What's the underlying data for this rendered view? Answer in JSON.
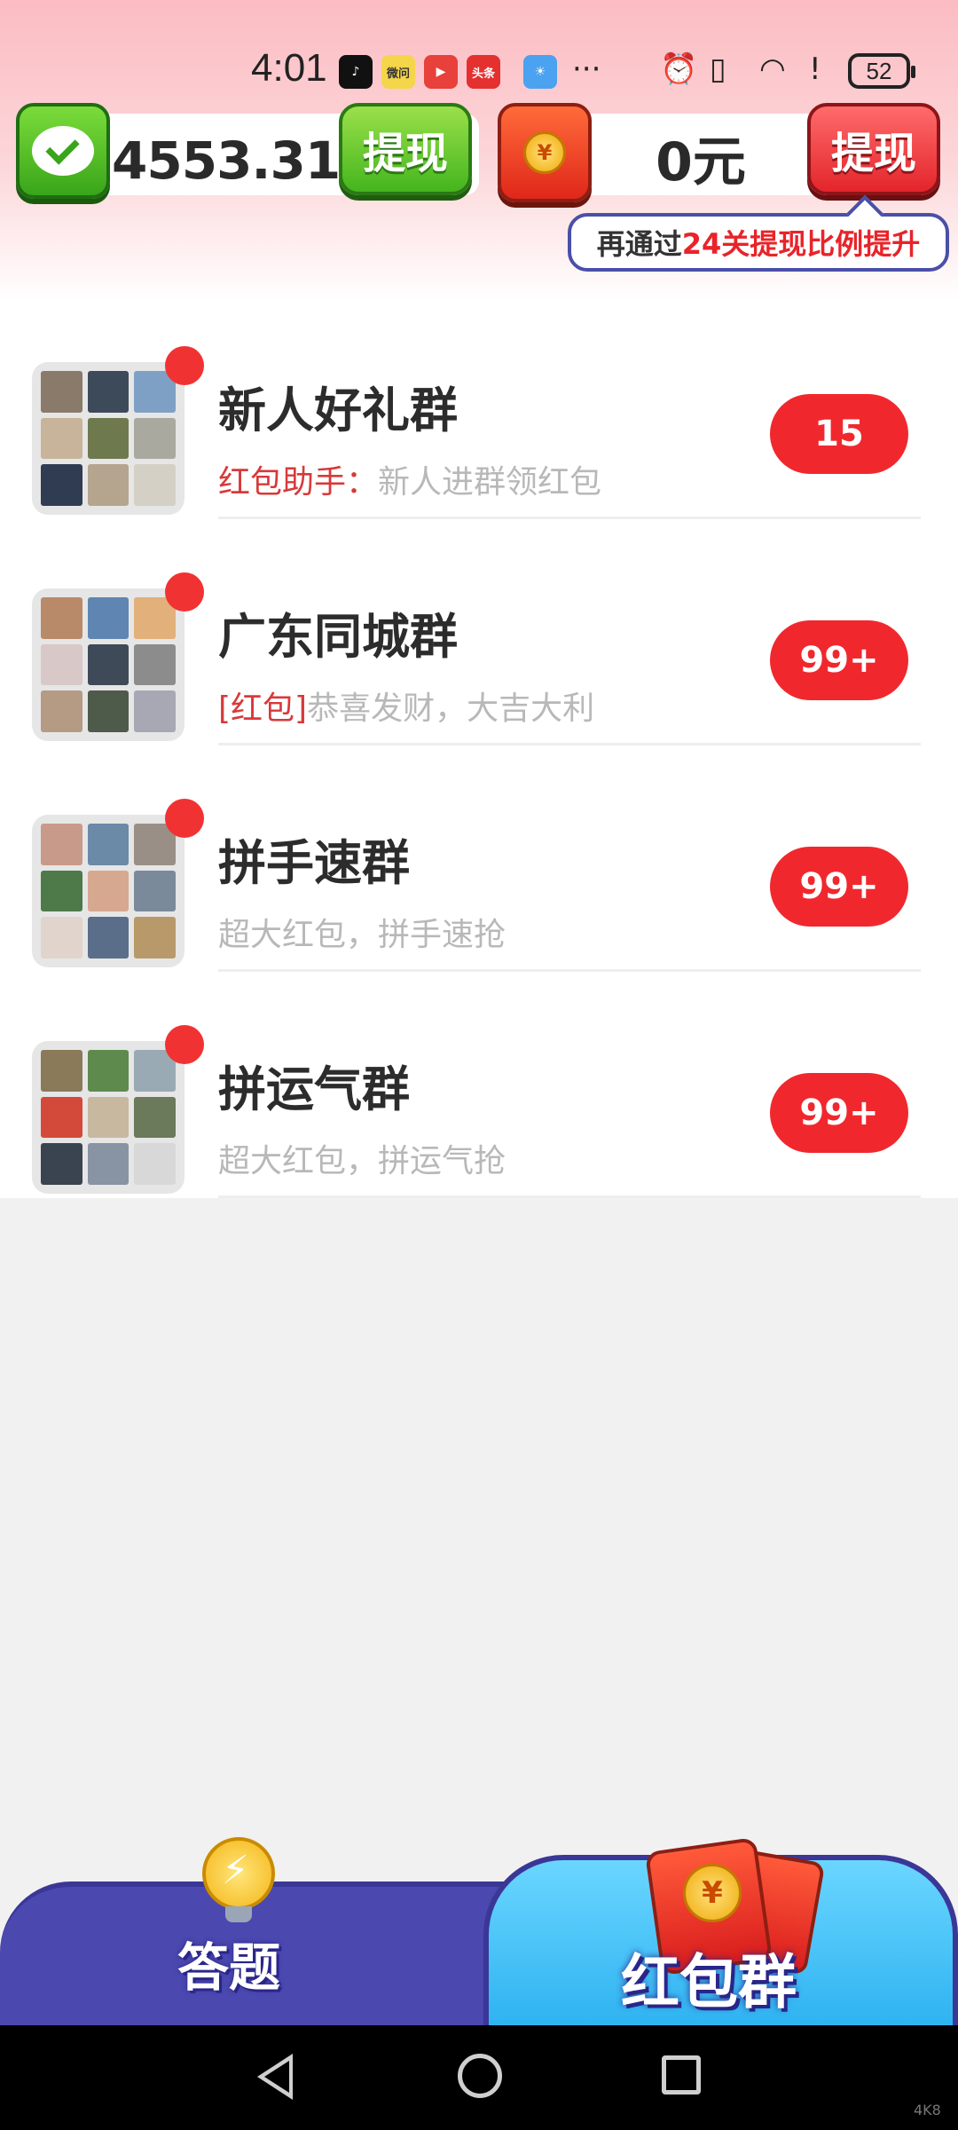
{
  "status_bar": {
    "time": "4:01",
    "apps": [
      "douyin-app-icon",
      "weiwen-app-icon",
      "video-app-icon",
      "toutiao-app-icon",
      "weather-app-icon"
    ],
    "app_labels": [
      "",
      "微问",
      "",
      "头条",
      ""
    ],
    "more": "···",
    "battery": "52"
  },
  "wallet": {
    "balance": "4553.31元",
    "withdraw_label": "提现"
  },
  "pocket": {
    "coin_symbol": "¥",
    "amount": "0元",
    "withdraw_label": "提现"
  },
  "tooltip": {
    "prefix": "再通过",
    "highlight": "24关提现比例提升"
  },
  "groups": [
    {
      "name": "新人好礼群",
      "preview_tag": "红包助手：",
      "preview_text": "新人进群领红包",
      "badge": "15",
      "tag_color": "#d8393a"
    },
    {
      "name": "广东同城群",
      "preview_tag": "[红包]",
      "preview_text": "恭喜发财，大吉大利",
      "badge": "99+"
    },
    {
      "name": "拼手速群",
      "preview_tag": "",
      "preview_text": "超大红包，拼手速抢",
      "badge": "99+"
    },
    {
      "name": "拼运气群",
      "preview_tag": "",
      "preview_text": "超大红包，拼运气抢",
      "badge": "99+"
    }
  ],
  "tabs": {
    "left_label": "答题",
    "right_label": "红包群",
    "coin_symbol": "¥"
  },
  "colors": {
    "accent_red": "#f0282e",
    "tab_blue": "#4b48b0",
    "tab_active": "#2fb3f1"
  },
  "watermark": "4K8"
}
